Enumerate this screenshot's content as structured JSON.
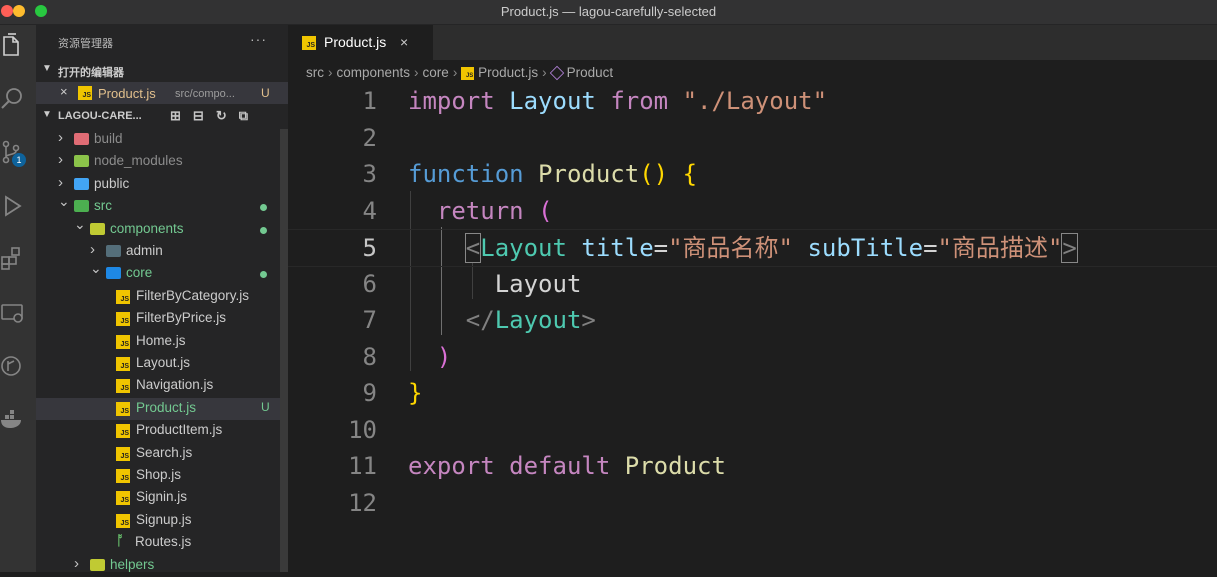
{
  "window": {
    "title": "Product.js — lagou-carefully-selected"
  },
  "activity_bar": {
    "scm_badge": "1"
  },
  "sidebar": {
    "header": "资源管理器",
    "more": "···",
    "open_editors": {
      "title": "打开的编辑器",
      "item": {
        "name": "Product.js",
        "path": "src/compo...",
        "status": "U"
      }
    },
    "project": {
      "title": "LAGOU-CARE..."
    },
    "tree": [
      {
        "name": "build",
        "type": "folder",
        "depth": 0,
        "expanded": false,
        "color": "#e06c75"
      },
      {
        "name": "node_modules",
        "type": "folder",
        "depth": 0,
        "expanded": false,
        "color": "#8bc34a"
      },
      {
        "name": "public",
        "type": "folder",
        "depth": 0,
        "expanded": false,
        "color": "#42a5f5"
      },
      {
        "name": "src",
        "type": "folder",
        "depth": 0,
        "expanded": true,
        "color": "#4caf50",
        "dot": true
      },
      {
        "name": "components",
        "type": "folder",
        "depth": 1,
        "expanded": true,
        "color": "#c0ca33",
        "dot": true
      },
      {
        "name": "admin",
        "type": "folder",
        "depth": 2,
        "expanded": false,
        "color": "#546e7a"
      },
      {
        "name": "core",
        "type": "folder",
        "depth": 2,
        "expanded": true,
        "color": "#1e88e5",
        "dot": true
      },
      {
        "name": "FilterByCategory.js",
        "type": "js",
        "depth": 3
      },
      {
        "name": "FilterByPrice.js",
        "type": "js",
        "depth": 3
      },
      {
        "name": "Home.js",
        "type": "js",
        "depth": 3
      },
      {
        "name": "Layout.js",
        "type": "js",
        "depth": 3
      },
      {
        "name": "Navigation.js",
        "type": "js",
        "depth": 3
      },
      {
        "name": "Product.js",
        "type": "js",
        "depth": 3,
        "selected": true,
        "status": "U"
      },
      {
        "name": "ProductItem.js",
        "type": "js",
        "depth": 3
      },
      {
        "name": "Search.js",
        "type": "js",
        "depth": 3
      },
      {
        "name": "Shop.js",
        "type": "js",
        "depth": 3
      },
      {
        "name": "Signin.js",
        "type": "js",
        "depth": 3
      },
      {
        "name": "Signup.js",
        "type": "js",
        "depth": 3
      },
      {
        "name": "Routes.js",
        "type": "routes",
        "depth": 2
      },
      {
        "name": "helpers",
        "type": "folder",
        "depth": 1,
        "expanded": false,
        "color": "#c0ca33"
      }
    ]
  },
  "editor": {
    "tab": {
      "label": "Product.js",
      "close": "×"
    },
    "breadcrumb": [
      "src",
      "components",
      "core",
      "Product.js",
      "Product"
    ],
    "active_line": 5,
    "lines": [
      {
        "n": "1",
        "tokens": [
          [
            "kw",
            "import"
          ],
          [
            "txt",
            " "
          ],
          [
            "id",
            "Layout"
          ],
          [
            "txt",
            " "
          ],
          [
            "kw",
            "from"
          ],
          [
            "txt",
            " "
          ],
          [
            "str",
            "\"./Layout\""
          ]
        ]
      },
      {
        "n": "2",
        "tokens": []
      },
      {
        "n": "3",
        "tokens": [
          [
            "fn-kw",
            "function"
          ],
          [
            "txt",
            " "
          ],
          [
            "fn",
            "Product"
          ],
          [
            "brace",
            "()"
          ],
          [
            "txt",
            " "
          ],
          [
            "brace",
            "{"
          ]
        ]
      },
      {
        "n": "4",
        "tokens": [
          [
            "txt",
            "  "
          ],
          [
            "kw",
            "return"
          ],
          [
            "txt",
            " "
          ],
          [
            "paren",
            "("
          ]
        ]
      },
      {
        "n": "5",
        "tokens": [
          [
            "txt",
            "    "
          ],
          [
            "tagp",
            "<"
          ],
          [
            "tag",
            "Layout"
          ],
          [
            "txt",
            " "
          ],
          [
            "attr",
            "title"
          ],
          [
            "txt",
            "="
          ],
          [
            "str",
            "\"商品名称\""
          ],
          [
            "txt",
            " "
          ],
          [
            "attr",
            "subTitle"
          ],
          [
            "txt",
            "="
          ],
          [
            "str",
            "\"商品描述\""
          ],
          [
            "tagp",
            ">"
          ]
        ]
      },
      {
        "n": "6",
        "tokens": [
          [
            "txt",
            "      Layout"
          ]
        ]
      },
      {
        "n": "7",
        "tokens": [
          [
            "txt",
            "    "
          ],
          [
            "tagp",
            "</"
          ],
          [
            "tag",
            "Layout"
          ],
          [
            "tagp",
            ">"
          ]
        ]
      },
      {
        "n": "8",
        "tokens": [
          [
            "txt",
            "  "
          ],
          [
            "paren",
            ")"
          ]
        ]
      },
      {
        "n": "9",
        "tokens": [
          [
            "brace",
            "}"
          ]
        ]
      },
      {
        "n": "10",
        "tokens": []
      },
      {
        "n": "11",
        "tokens": [
          [
            "kw",
            "export"
          ],
          [
            "txt",
            " "
          ],
          [
            "kw",
            "default"
          ],
          [
            "txt",
            " "
          ],
          [
            "fn",
            "Product"
          ]
        ]
      },
      {
        "n": "12",
        "tokens": []
      }
    ]
  }
}
